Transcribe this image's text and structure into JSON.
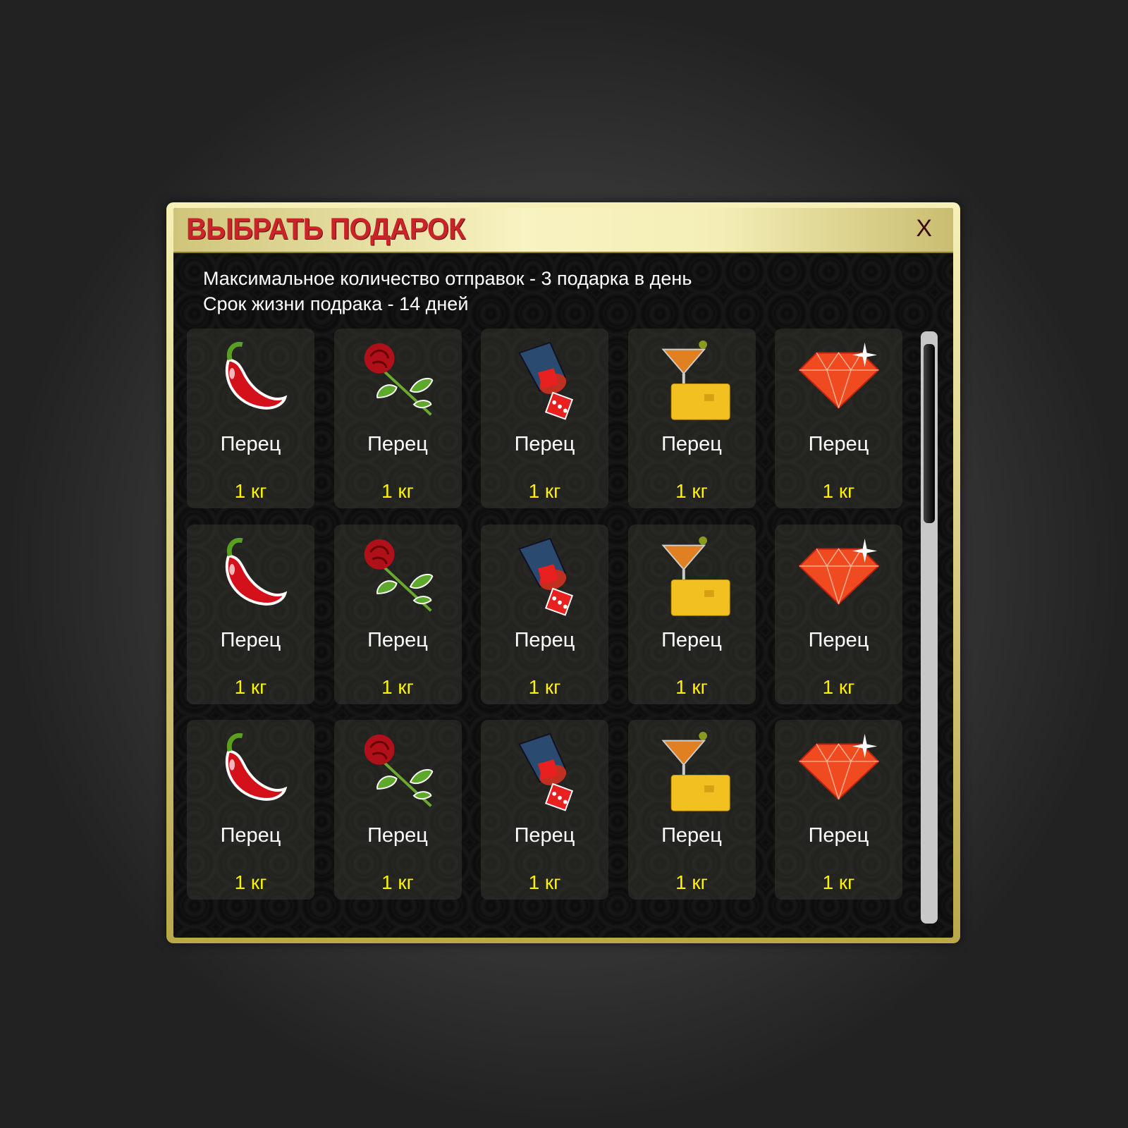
{
  "dialog": {
    "title": "ВЫБРАТЬ ПОДАРОК",
    "close_label": "X"
  },
  "info": {
    "line1": "Максимальное количество отправок - 3 подарка в день",
    "line2": "Срок жизни подрака - 14 дней"
  },
  "gifts": [
    {
      "icon": "chili-pepper-icon",
      "name": "Перец",
      "weight": "1 кг"
    },
    {
      "icon": "rose-icon",
      "name": "Перец",
      "weight": "1 кг"
    },
    {
      "icon": "dice-cup-icon",
      "name": "Перец",
      "weight": "1 кг"
    },
    {
      "icon": "cocktail-card-icon",
      "name": "Перец",
      "weight": "1 кг"
    },
    {
      "icon": "gem-icon",
      "name": "Перец",
      "weight": "1 кг"
    },
    {
      "icon": "chili-pepper-icon",
      "name": "Перец",
      "weight": "1 кг"
    },
    {
      "icon": "rose-icon",
      "name": "Перец",
      "weight": "1 кг"
    },
    {
      "icon": "dice-cup-icon",
      "name": "Перец",
      "weight": "1 кг"
    },
    {
      "icon": "cocktail-card-icon",
      "name": "Перец",
      "weight": "1 кг"
    },
    {
      "icon": "gem-icon",
      "name": "Перец",
      "weight": "1 кг"
    },
    {
      "icon": "chili-pepper-icon",
      "name": "Перец",
      "weight": "1 кг"
    },
    {
      "icon": "rose-icon",
      "name": "Перец",
      "weight": "1 кг"
    },
    {
      "icon": "dice-cup-icon",
      "name": "Перец",
      "weight": "1 кг"
    },
    {
      "icon": "cocktail-card-icon",
      "name": "Перец",
      "weight": "1 кг"
    },
    {
      "icon": "gem-icon",
      "name": "Перец",
      "weight": "1 кг"
    }
  ],
  "colors": {
    "title": "#c8242a",
    "weight": "#fff200"
  }
}
